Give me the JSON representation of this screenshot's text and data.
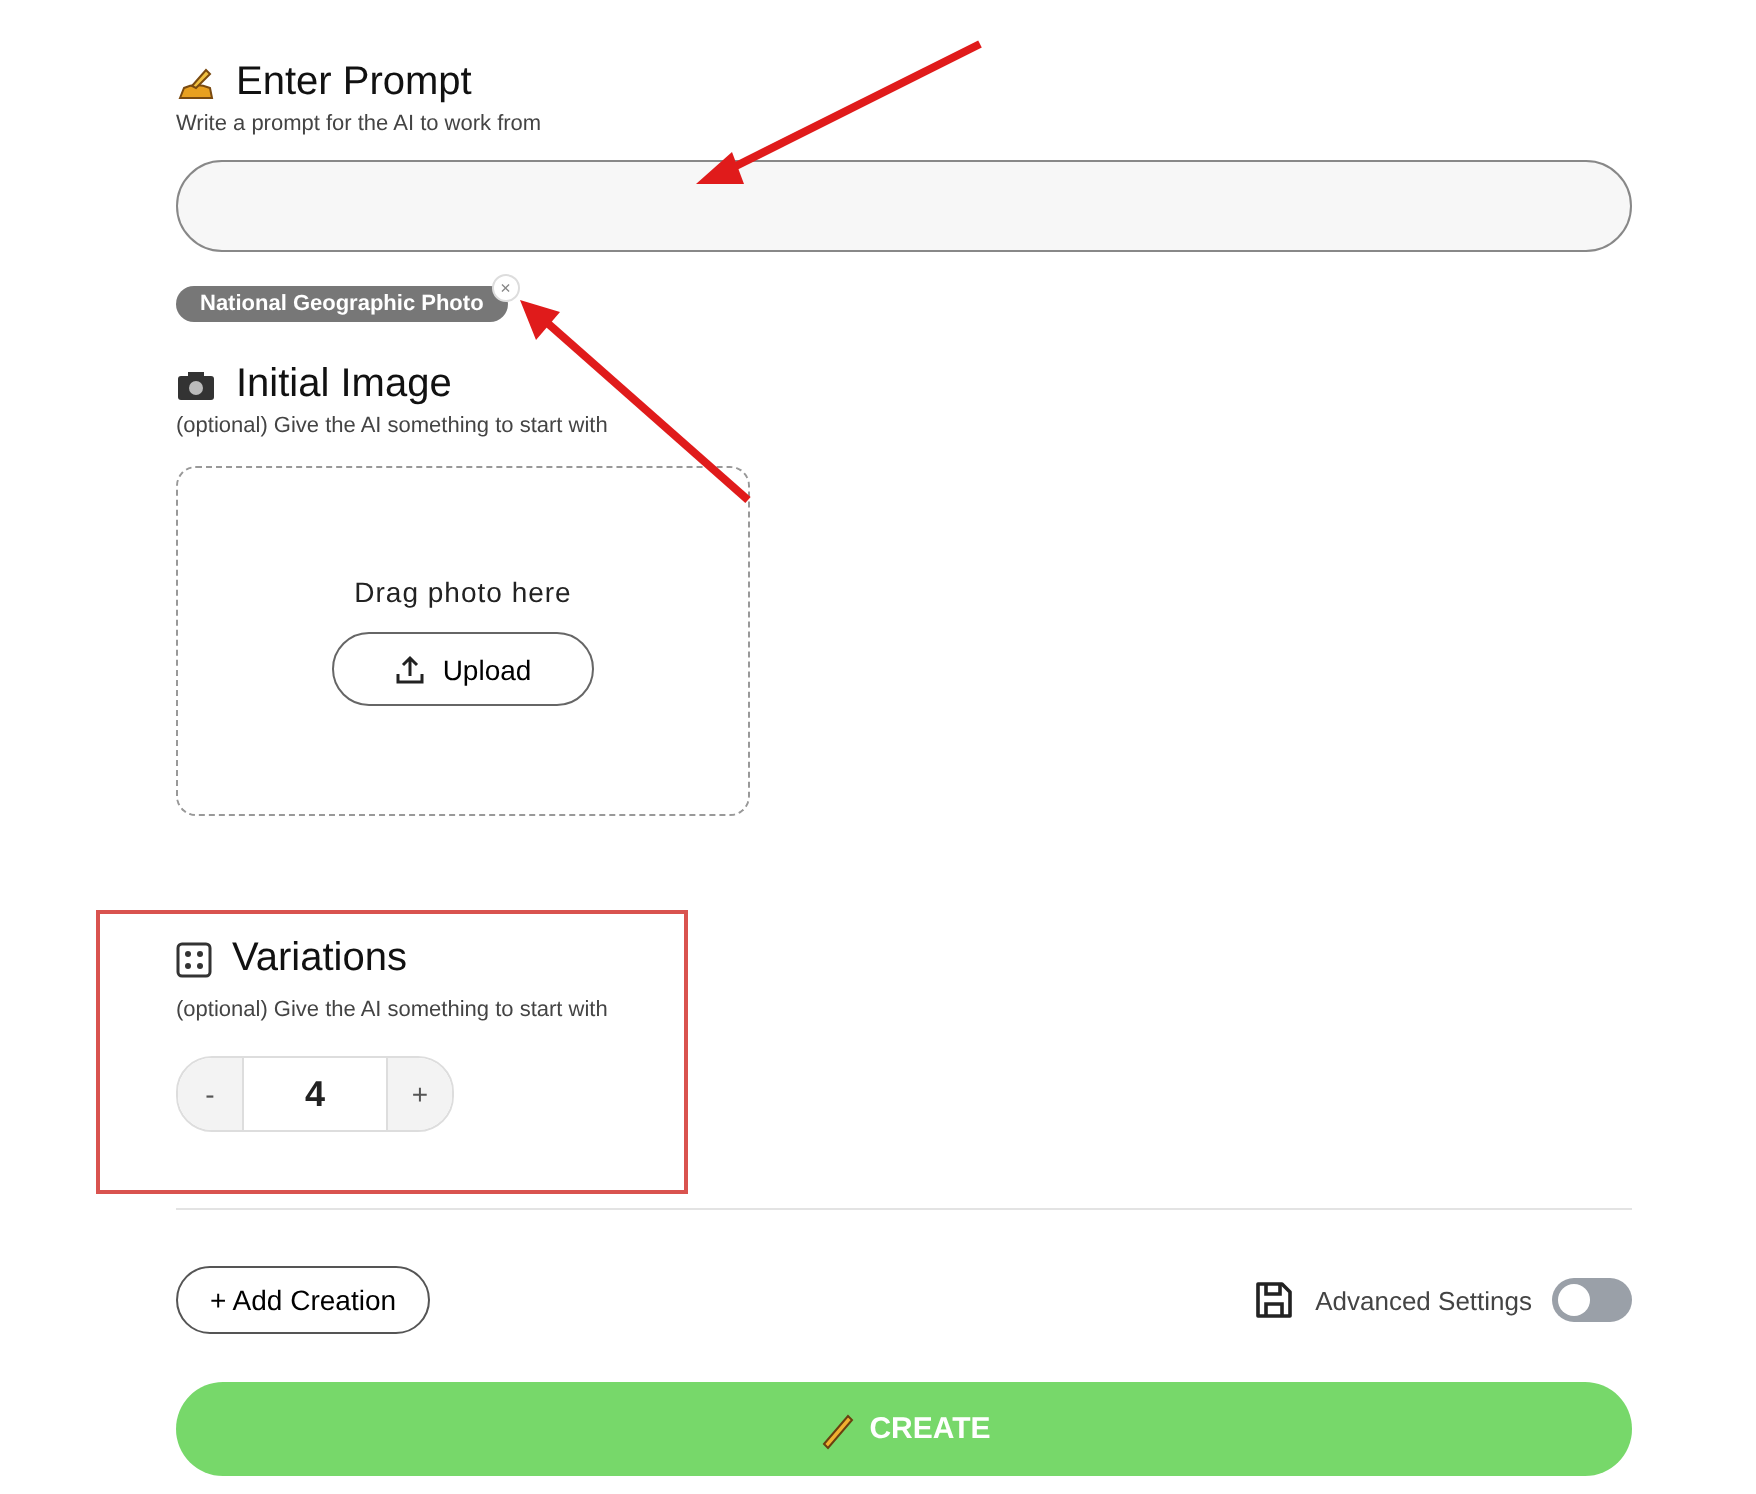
{
  "prompt": {
    "title": "Enter Prompt",
    "subtitle": "Write a prompt for the AI to work from",
    "tags": [
      {
        "label": "National Geographic Photo",
        "remove": "×"
      }
    ]
  },
  "initial_image": {
    "title": "Initial Image",
    "subtitle": "(optional) Give the AI something to start with",
    "drop_text": "Drag photo here",
    "upload_button": "Upload"
  },
  "variations": {
    "title": "Variations",
    "subtitle": "(optional) Give the AI something to start with",
    "decrement": "-",
    "value": "4",
    "increment": "+"
  },
  "add_button": "+ Add Creation",
  "advanced_settings": {
    "label": "Advanced Settings",
    "on": false
  },
  "create_button": "CREATE"
}
